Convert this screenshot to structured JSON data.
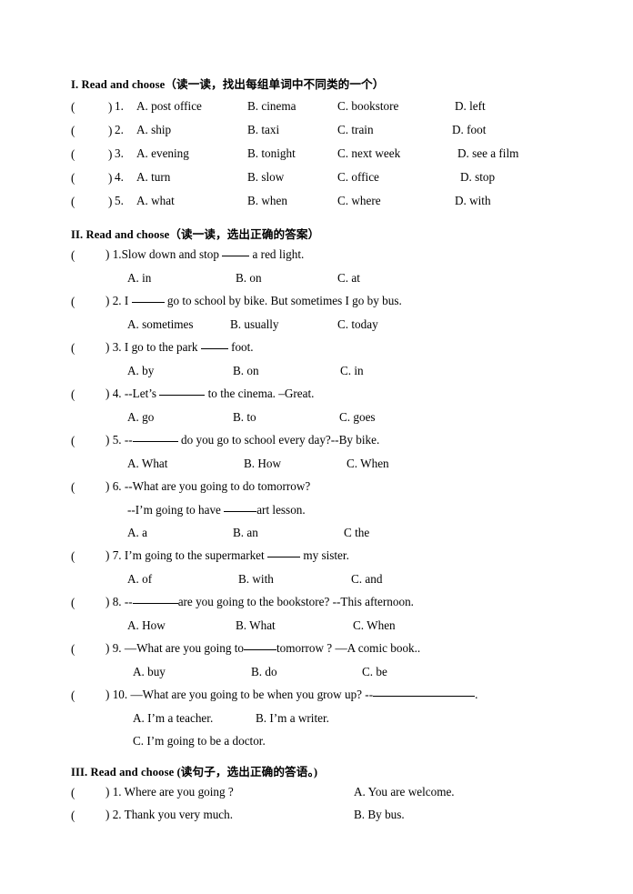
{
  "document": {
    "type": "english-worksheet",
    "sections": [
      {
        "id": "section-1",
        "heading": "I. Read and choose（读一读，找出每组单词中不同类的一个）",
        "heading_label": "I. Read and choose",
        "heading_note": "（读一读，找出每组单词中不同类的一个）",
        "items": [
          {
            "bracket": "(",
            "close": ")",
            "number": "1.",
            "options": [
              "A. post office",
              "B. cinema",
              "C. bookstore",
              "D. left"
            ]
          },
          {
            "bracket": "(",
            "close": ")",
            "number": "2.",
            "options": [
              "A. ship",
              "B. taxi",
              "C. train",
              "D. foot"
            ]
          },
          {
            "bracket": "(",
            "close": ")",
            "number": "3.",
            "options": [
              "A. evening",
              "B. tonight",
              "C. next week",
              "D. see a film"
            ]
          },
          {
            "bracket": "(",
            "close": ")",
            "number": "4.",
            "options": [
              "A. turn",
              "B. slow",
              "C. office",
              "D. stop"
            ]
          },
          {
            "bracket": "(",
            "close": ")",
            "number": "5.",
            "options": [
              "A. what",
              "B. when",
              "C. where",
              "D. with"
            ]
          }
        ]
      },
      {
        "id": "section-2",
        "heading": "II. Read and choose（读一读，选出正确的答案）",
        "heading_label": "II. Read and choose",
        "heading_note": "（读一读，选出正确的答案）",
        "items": [
          {
            "number": "1.",
            "stem_before": "Slow down and stop ",
            "stem_after": " a red light.",
            "blank": "short",
            "options": [
              "A. in",
              "B. on",
              "C. at"
            ]
          },
          {
            "number": "2.",
            "stem_before": "I ",
            "stem_after": " go to school by bike. But sometimes I go by bus.",
            "blank": "medium",
            "options": [
              "A. sometimes",
              "B. usually",
              "C. today"
            ]
          },
          {
            "number": "3.",
            "stem_before": "I go to the park ",
            "stem_after": " foot.",
            "blank": "short",
            "options": [
              "A. by",
              "B. on",
              "C. in"
            ]
          },
          {
            "number": "4.",
            "stem_before": "--Let’s ",
            "stem_after": " to the cinema.   –Great.",
            "blank": "large",
            "options": [
              "A. go",
              "B. to",
              "C. goes"
            ]
          },
          {
            "number": "5.",
            "stem_before": "--",
            "stem_after": " do you go to school every day?--By bike.",
            "blank": "large",
            "options": [
              "A. What",
              "B. How",
              "C. When"
            ]
          },
          {
            "number": "6.",
            "stem_before": "--What are you going to do tomorrow?",
            "stem_after": "",
            "blank": "none",
            "subline_before": "--I’m going to have ",
            "subline_after": "art lesson.",
            "subline_blank": "medium",
            "options": [
              "A. a",
              "B. an",
              "C the"
            ]
          },
          {
            "number": "7.",
            "stem_before": "I’m going to the supermarket ",
            "stem_after": " my sister.",
            "blank": "medium",
            "options": [
              "A. of",
              "B. with",
              "C. and"
            ]
          },
          {
            "number": "8.",
            "stem_before": "--",
            "stem_after": "are you going to the bookstore?        --This  afternoon.",
            "blank": "large",
            "options": [
              "A. How",
              "B. What",
              "C. When"
            ]
          },
          {
            "number": "9.",
            "stem_before": "—What are you going to",
            "stem_after": "tomorrow ?    —A comic book..",
            "blank": "medium",
            "options": [
              "A. buy",
              "B. do",
              "C. be"
            ]
          },
          {
            "number": "10.",
            "stem_before": "—What are you going to be when you grow up?   --",
            "stem_after": ".",
            "blank": "xlarge",
            "options_line1": [
              "A. I’m a teacher.",
              "B. I’m a writer."
            ],
            "options_line2": [
              "C. I’m going to be a doctor."
            ]
          }
        ]
      },
      {
        "id": "section-3",
        "heading": "III. Read and choose (读句子，选出正确的答语。)",
        "heading_label": "III. Read and choose",
        "heading_note": "(读句子，选出正确的答语。)",
        "items": [
          {
            "number": "1.",
            "prompt": "Where are you going ?",
            "answer": "A. You are welcome."
          },
          {
            "number": "2.",
            "prompt": "Thank you very much.",
            "answer": "B. By bus."
          }
        ]
      }
    ],
    "bracket_open": "(",
    "bracket_close": ")"
  }
}
